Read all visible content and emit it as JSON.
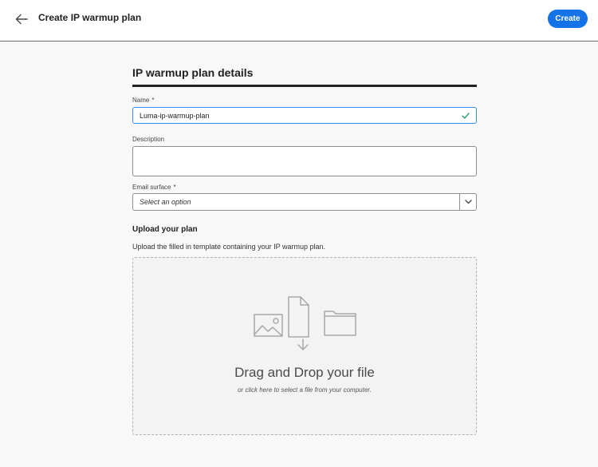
{
  "header": {
    "title": "Create IP warmup plan",
    "create_label": "Create",
    "back_icon": "arrow-left-icon"
  },
  "form": {
    "section_title": "IP warmup plan details",
    "name": {
      "label": "Name",
      "required_mark": "*",
      "value": "Luma-ip-warmup-plan",
      "valid_icon": "checkmark-icon"
    },
    "description": {
      "label": "Description",
      "value": ""
    },
    "email_surface": {
      "label": "Email surface",
      "required_mark": "*",
      "placeholder": "Select an option"
    }
  },
  "upload": {
    "title": "Upload your plan",
    "description": "Upload the filled in template containing your IP warmup plan.",
    "drop_title": "Drag and Drop your file",
    "drop_subtitle": "or click here to select a file from your computer."
  },
  "colors": {
    "accent": "#1473e6",
    "valid": "#2d9d78",
    "focus_border": "#378ef0"
  }
}
